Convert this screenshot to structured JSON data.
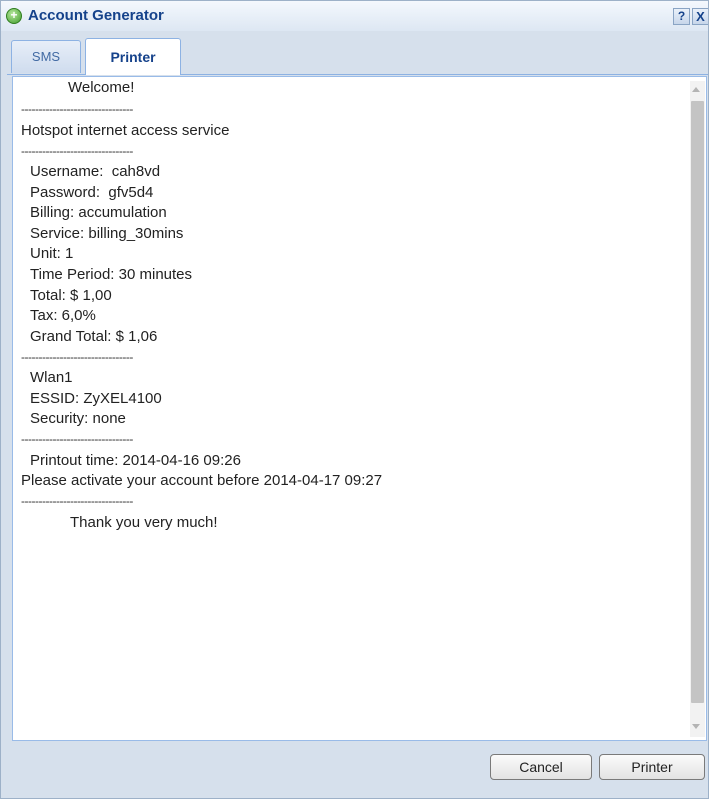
{
  "window": {
    "title": "Account Generator",
    "help_label": "?",
    "close_label": "X"
  },
  "tabs": [
    {
      "label": "SMS",
      "active": false
    },
    {
      "label": "Printer",
      "active": true
    }
  ],
  "receipt": {
    "welcome": "Welcome!",
    "separator": "--------------------------------",
    "service_name": "Hotspot internet access service",
    "account_lines": [
      "Username:  cah8vd",
      "Password:  gfv5d4",
      "Billing: accumulation",
      "Service: billing_30mins",
      "Unit: 1",
      "Time Period: 30 minutes",
      "Total: $ 1,00",
      "Tax: 6,0%",
      "Grand Total: $ 1,06"
    ],
    "network_lines": [
      "Wlan1",
      "ESSID: ZyXEL4100",
      "Security: none"
    ],
    "printout_time": "Printout time: 2014-04-16 09:26",
    "activate_notice": "Please activate your account before 2014-04-17 09:27",
    "thanks": "Thank you very much!"
  },
  "buttons": {
    "cancel": "Cancel",
    "printer": "Printer"
  },
  "colors": {
    "title_text": "#15428b",
    "dialog_bg": "#d6e0ec",
    "panel_border": "#99bbe8"
  }
}
